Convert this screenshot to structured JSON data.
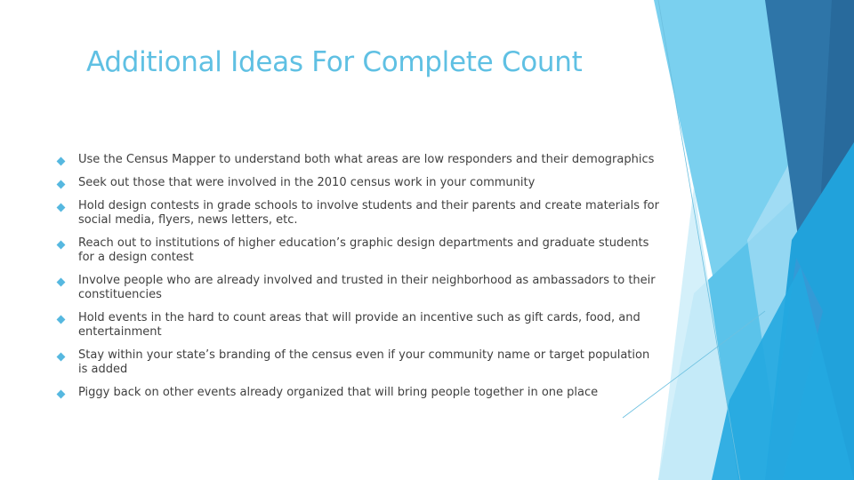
{
  "slide": {
    "title": "Additional Ideas For Complete Count",
    "bullet_icon": "diamond-bullet",
    "accent_color": "#5fc0e3",
    "bullets": [
      "Use the Census Mapper to understand both what areas are low responders and their demographics",
      "Seek out those that were involved in the 2010 census work in your community",
      "Hold design contests in grade schools to involve students and their parents and create materials for social media, flyers, news letters, etc.",
      "Reach out to institutions of higher education’s graphic design departments and graduate students for a design contest",
      "Involve people who are already involved and trusted in their neighborhood as ambassadors to their constituencies",
      "Hold events in the hard to count areas that will provide an incentive such as gift cards, food, and entertainment",
      "Stay within your state’s branding of the census even if your community name or target population is added",
      "Piggy back on other events already organized that will bring people together in one place"
    ]
  }
}
